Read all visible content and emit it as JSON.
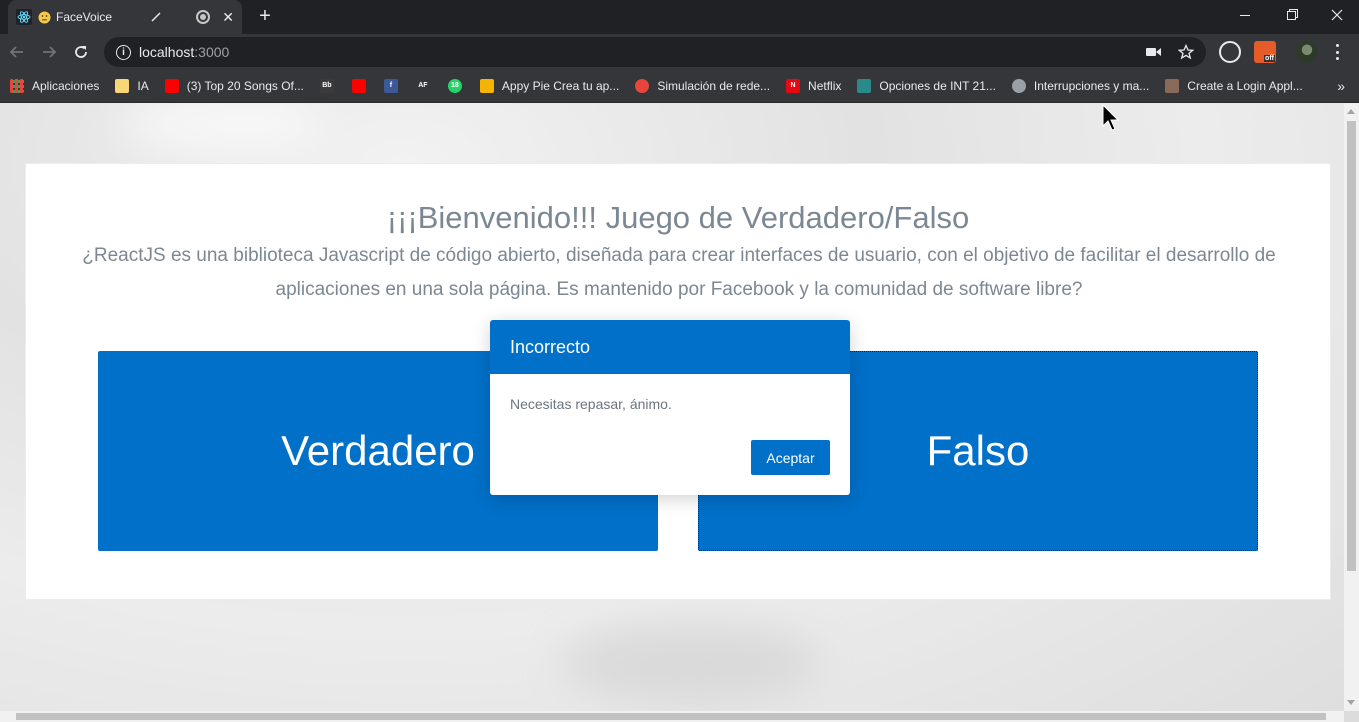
{
  "browser": {
    "tab_title": "FaceVoice",
    "address_host": "localhost",
    "address_port": ":3000",
    "bookmarks": [
      {
        "label": "Aplicaciones",
        "icon": "apps-grid-icon",
        "color": "#e8453c"
      },
      {
        "label": "IA",
        "icon": "folder-icon",
        "color": "#f8d775"
      },
      {
        "label": "(3) Top 20 Songs Of...",
        "icon": "youtube-icon",
        "color": "#ff0000"
      },
      {
        "label": "",
        "icon": "bb-icon",
        "color": "#3a3a3a",
        "glyph": "Bb"
      },
      {
        "label": "",
        "icon": "youtube-icon",
        "color": "#ff0000"
      },
      {
        "label": "",
        "icon": "facebook-icon",
        "color": "#3b5998",
        "glyph": "f"
      },
      {
        "label": "",
        "icon": "af-icon",
        "color": "#35363a",
        "glyph": "AF"
      },
      {
        "label": "",
        "icon": "whatsapp-icon",
        "color": "#25d366",
        "glyph": "18"
      },
      {
        "label": "Appy Pie Crea tu ap...",
        "icon": "appypie-icon",
        "color": "#f4b400"
      },
      {
        "label": "Simulación de rede...",
        "icon": "target-icon",
        "color": "#e8453c"
      },
      {
        "label": "Netflix",
        "icon": "netflix-icon",
        "color": "#e50914",
        "glyph": "N"
      },
      {
        "label": "Opciones de INT 21...",
        "icon": "site-icon",
        "color": "#2a8a8a"
      },
      {
        "label": "Interrupciones y ma...",
        "icon": "globe-icon",
        "color": "#9aa0a6"
      },
      {
        "label": "Create a Login Appl...",
        "icon": "site-icon",
        "color": "#8a6a5a"
      }
    ],
    "bookmarks_more": "»"
  },
  "page": {
    "heading": "¡¡¡Bienvenido!!! Juego de Verdadero/Falso",
    "question": "¿ReactJS es una biblioteca Javascript de código abierto, diseñada para crear interfaces de usuario, con el objetivo de facilitar el desarrollo de aplicaciones en una sola página. Es mantenido por Facebook y la comunidad de software libre?",
    "true_label": "Verdadero",
    "false_label": "Falso"
  },
  "modal": {
    "title": "Incorrecto",
    "message": "Necesitas repasar, ánimo.",
    "accept_label": "Aceptar"
  },
  "colors": {
    "primary": "#0070c9",
    "text_muted": "#7b8893"
  }
}
